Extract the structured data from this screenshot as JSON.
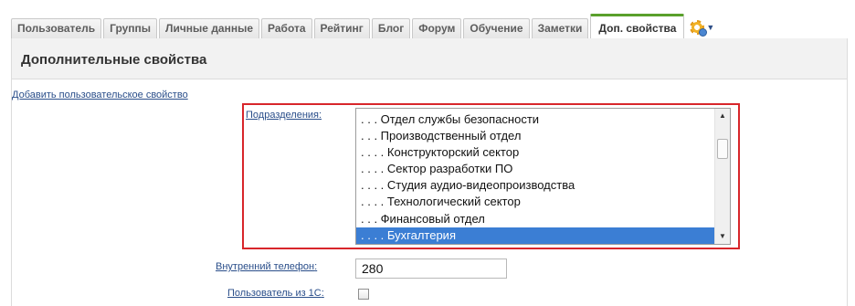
{
  "tabs": [
    {
      "label": "Пользователь"
    },
    {
      "label": "Группы"
    },
    {
      "label": "Личные данные"
    },
    {
      "label": "Работа"
    },
    {
      "label": "Рейтинг"
    },
    {
      "label": "Блог"
    },
    {
      "label": "Форум"
    },
    {
      "label": "Обучение"
    },
    {
      "label": "Заметки"
    },
    {
      "label": "Доп. свойства"
    }
  ],
  "active_tab": "Доп. свойства",
  "section": {
    "title": "Дополнительные свойства"
  },
  "actions": {
    "add_property": "Добавить пользовательское свойство"
  },
  "fields": {
    "departments": {
      "label": "Подразделения",
      "options": [
        ". . . Отдел службы безопасности",
        ". . . Производственный отдел",
        ". . . . Конструкторский сектор",
        ". . . . Сектор разработки ПО",
        ". . . . Студия аудио-видеопроизводства",
        ". . . . Технологический сектор",
        ". . . Финансовый отдел",
        ". . . . Бухгалтерия"
      ],
      "selected_index": 7
    },
    "phone": {
      "label": "Внутренний телефон",
      "value": "280"
    },
    "from_1c": {
      "label": "Пользователь из 1С",
      "checked": false
    }
  },
  "colors": {
    "active_tab_accent": "#5aa02c",
    "highlight": "#d8262b",
    "selection": "#3b7ed4",
    "link": "#2a4e8a"
  }
}
